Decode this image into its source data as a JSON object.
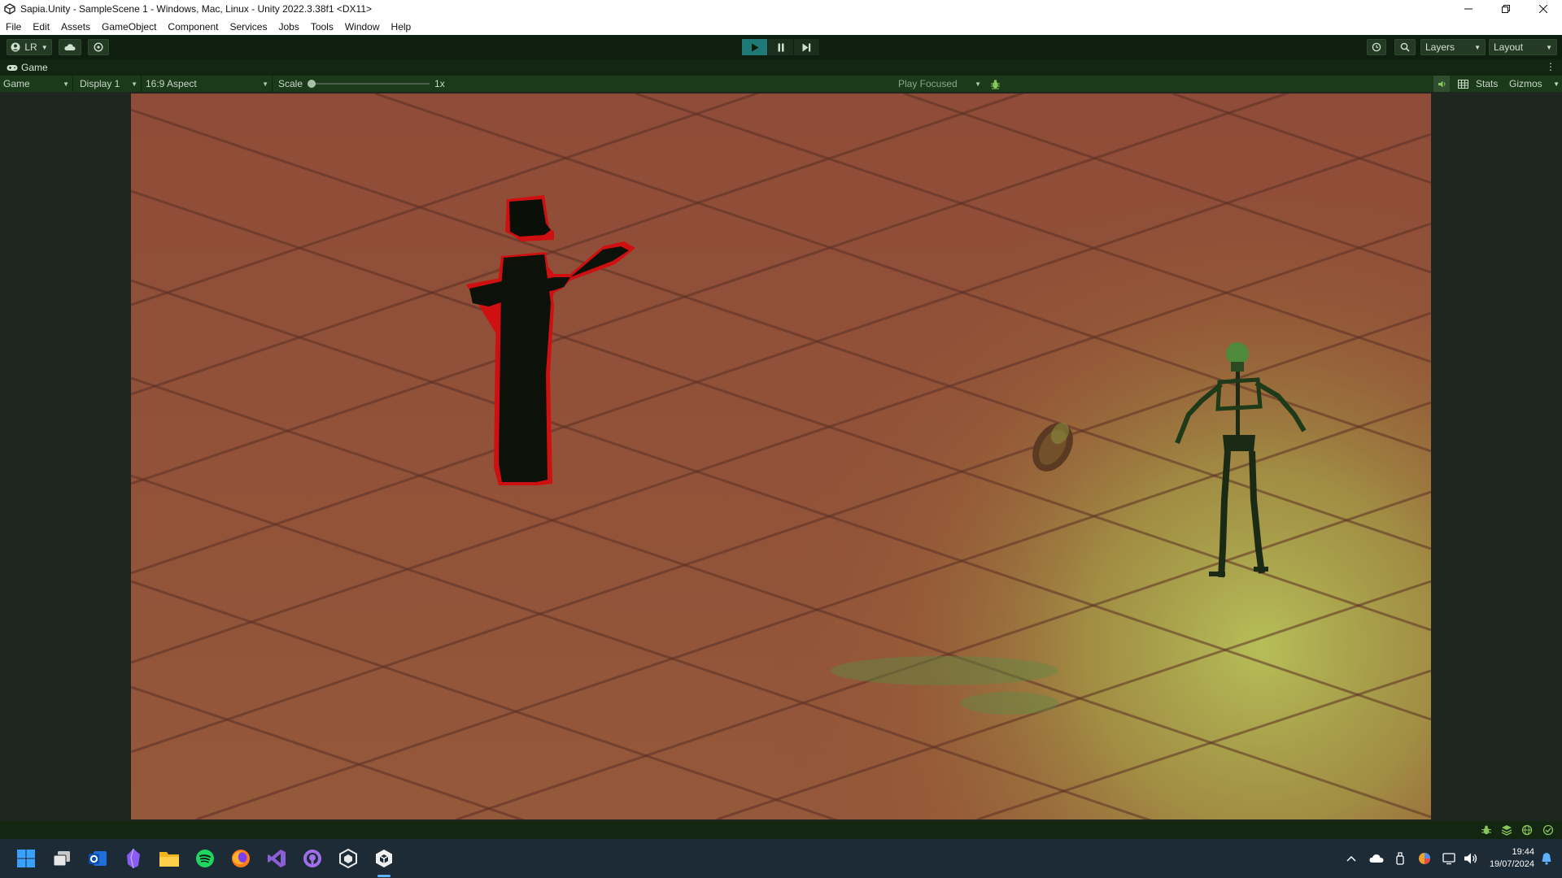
{
  "window": {
    "title": "Sapia.Unity - SampleScene 1 - Windows, Mac, Linux - Unity 2022.3.38f1 <DX11>",
    "controls": [
      "minimize",
      "restore",
      "close"
    ]
  },
  "menu": {
    "items": [
      "File",
      "Edit",
      "Assets",
      "GameObject",
      "Component",
      "Services",
      "Jobs",
      "Tools",
      "Window",
      "Help"
    ]
  },
  "toolbar": {
    "account_label": "LR",
    "layers_label": "Layers",
    "layout_label": "Layout"
  },
  "game_tab": {
    "label": "Game"
  },
  "game_controls": {
    "view_mode": "Game",
    "display": "Display 1",
    "aspect": "16:9 Aspect",
    "scale_label": "Scale",
    "scale_value": "1x",
    "play_mode": "Play Focused",
    "stats_label": "Stats",
    "gizmos_label": "Gizmos"
  },
  "taskbar": {
    "apps": [
      "start",
      "task-view",
      "outlook",
      "obsidian",
      "file-explorer",
      "spotify",
      "firefox",
      "visual-studio",
      "github-desktop",
      "unity-hub",
      "unity-editor"
    ],
    "time": "19:44",
    "date": "19/07/2024"
  }
}
